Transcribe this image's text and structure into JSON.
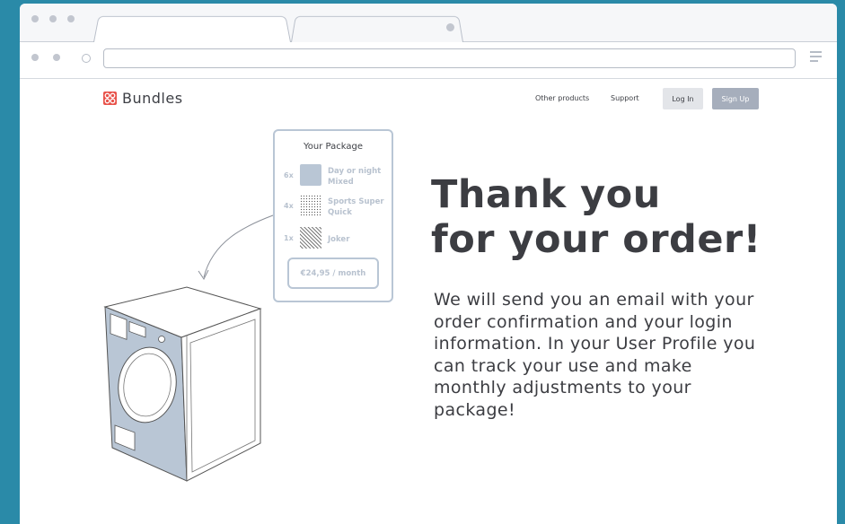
{
  "brand": {
    "name": "Bundles",
    "accent": "#e8524a"
  },
  "nav": {
    "links": [
      "Other products",
      "Support"
    ],
    "login_label": "Log In",
    "signup_label": "Sign Up"
  },
  "package": {
    "title": "Your Package",
    "items": [
      {
        "qty": "6x",
        "name_line1": "Day or night",
        "name_line2": "Mixed",
        "swatch": "solid"
      },
      {
        "qty": "4x",
        "name_line1": "Sports Super",
        "name_line2": "Quick",
        "swatch": "dots"
      },
      {
        "qty": "1x",
        "name_line1": "Joker",
        "name_line2": "",
        "swatch": "stripes"
      }
    ],
    "price": "€24,95 / month"
  },
  "main": {
    "headline_line1": "Thank you",
    "headline_line2": "for your order!",
    "message": "We will send you an email with your order confirmation and your login information. In your User Profile you can track your use and make monthly adjustments to your package!"
  },
  "colors": {
    "background": "#2a8aa8",
    "card_border": "#b9c6d5",
    "machine_fill": "#b9c6d5"
  }
}
